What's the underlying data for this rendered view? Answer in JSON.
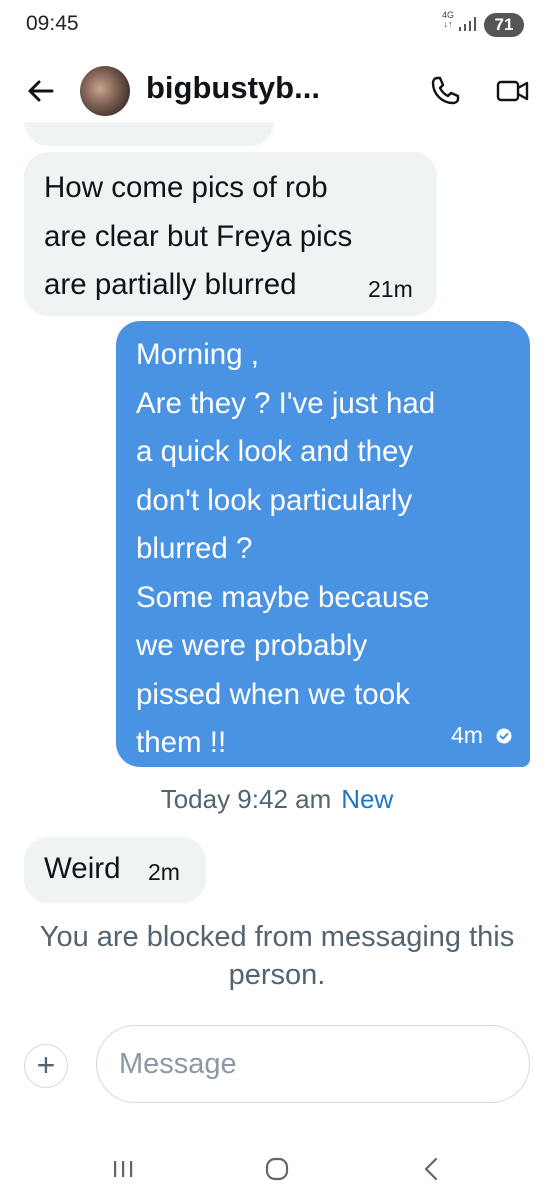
{
  "status_bar": {
    "time": "09:45",
    "network": "4G",
    "battery": "71"
  },
  "header": {
    "contact_name": "bigbustyb..."
  },
  "messages": [
    {
      "direction": "received",
      "text": "How come pics of rob\nare clear but Freya pics\nare partially blurred",
      "time": "21m"
    },
    {
      "direction": "sent",
      "text": "Morning ,\nAre they ? I've just had\na quick look and they\ndon't look particularly\nblurred ?\nSome maybe because\nwe were probably\npissed when we took\nthem !!",
      "time": "4m"
    },
    {
      "direction": "received",
      "text": "Weird",
      "time": "2m"
    }
  ],
  "divider": {
    "label": "Today 9:42 am",
    "new_label": "New"
  },
  "blocked_notice": "You are blocked from messaging this person.",
  "composer": {
    "placeholder": "Message",
    "value": ""
  },
  "colors": {
    "sent_bubble": "#4a93e2",
    "received_bubble": "#eff3f4",
    "accent": "#1d76c9"
  }
}
